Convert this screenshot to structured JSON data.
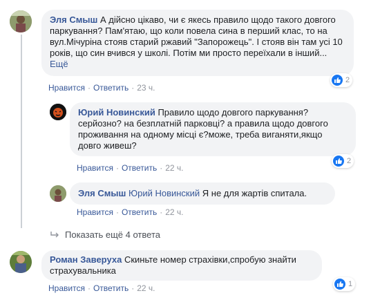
{
  "comments": [
    {
      "author": "Эля Смыш",
      "text": "А дійсно цікаво, чи є якесь правило щодо такого довгого паркування? Пам'ятаю, що коли повела сина в перший клас, то на вул.Мічуріна стояв старий ржавий \"Запорожець\". І стояв він там усі 10 років, що син вчився у школі. Потім ми просто переїхали в інший...",
      "more": "Ещё",
      "like": "Нравится",
      "reply": "Ответить",
      "time": "23 ч.",
      "reactions": "2"
    },
    {
      "author": "Юрий Новинский",
      "text": "Правило щодо довгого паркування? серйозно? на безплатній парковці? а правила щодо довгого проживання на одному місці є?може, треба виганяти,якщо довго живеш?",
      "like": "Нравится",
      "reply": "Ответить",
      "time": "22 ч.",
      "reactions": "2"
    },
    {
      "author": "Эля Смыш",
      "mention": "Юрий Новинский",
      "text": "Я не для жартів спитала.",
      "like": "Нравится",
      "reply": "Ответить",
      "time": "22 ч."
    },
    {
      "author": "Роман Заверуха",
      "text": "Скиньте номер страхівки,спробую знайти страхувальника",
      "like": "Нравится",
      "reply": "Ответить",
      "time": "22 ч.",
      "reactions": "1"
    }
  ],
  "show_more_replies": "Показать ещё 4 ответа",
  "colors": {
    "link": "#385898",
    "bubble": "#f2f3f5",
    "meta": "#90949c",
    "like": "#1877f2"
  }
}
